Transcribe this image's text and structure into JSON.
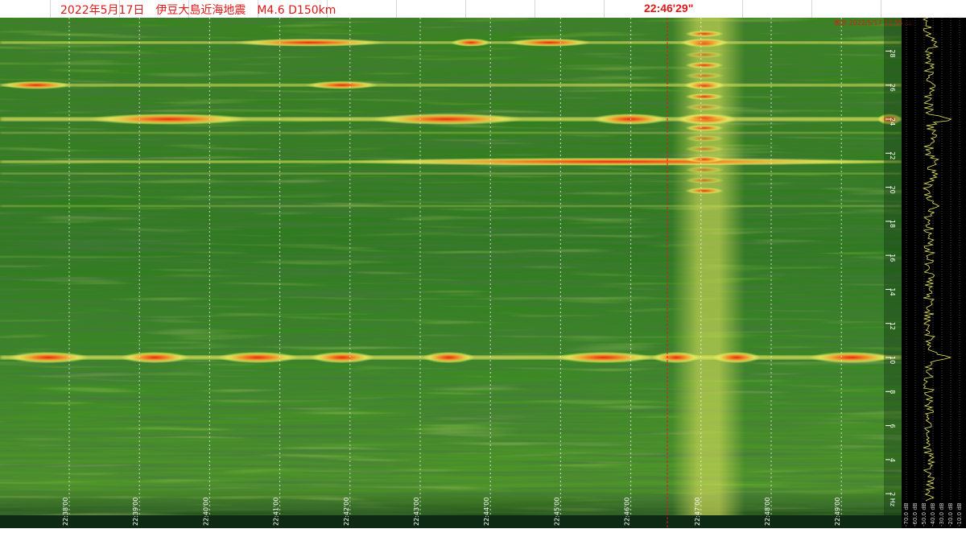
{
  "header": {
    "title": "2022年5月17日　伊豆大島近海地震　M4.6 D150km",
    "event_time": "22:46'29\"",
    "panel_header": "表示 2022/5/17 22:55 …"
  },
  "colors": {
    "title_text": "#e01818",
    "event_line": "#e01818",
    "background_low": "#0e2e12",
    "background_mid": "#3f8a1e",
    "band_high": "#f0f060",
    "band_peak": "#e62a10",
    "waveform": "#e8e860"
  },
  "chart_data": {
    "type": "heatmap",
    "title": "2022年5月17日　伊豆大島近海地震　M4.6 D150km",
    "xlabel": "",
    "ylabel": "",
    "x_ticks": [
      "22:38'00",
      "22:39'00",
      "22:40'00",
      "22:41'00",
      "22:42'00",
      "22:43'00",
      "22:44'00",
      "22:45'00",
      "22:46'00",
      "22:47'00",
      "22:48'00",
      "22:49'00"
    ],
    "y_unit": "Hz",
    "y_ticks": [
      2,
      4,
      6,
      8,
      10,
      12,
      14,
      16,
      18,
      20,
      22,
      24,
      26,
      28
    ],
    "ylim": [
      0,
      30
    ],
    "xlim": [
      "22:37'06",
      "22:49'32"
    ],
    "event_marker": "22:46'29\"",
    "strong_bands_hz": [
      {
        "freq": 10.0,
        "intensity": "peak"
      },
      {
        "freq": 24.0,
        "intensity": "peak"
      },
      {
        "freq": 28.5,
        "intensity": "high"
      },
      {
        "freq": 26.0,
        "intensity": "high"
      },
      {
        "freq": 21.5,
        "intensity": "high"
      },
      {
        "freq": 23.2,
        "intensity": "medium"
      },
      {
        "freq": 18.9,
        "intensity": "medium"
      },
      {
        "freq": 20.8,
        "intensity": "medium"
      }
    ],
    "event_column_time": "22:47'00",
    "amplitude_axis_labels": [
      "-70.0 dB",
      "-60.0 dB",
      "-50.0 dB",
      "-40.0 dB",
      "-30.0 dB",
      "-20.0 dB",
      "-10.0 dB"
    ],
    "grid": true
  }
}
